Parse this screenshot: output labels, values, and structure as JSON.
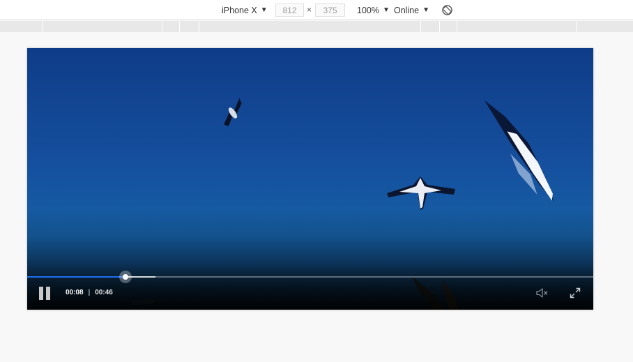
{
  "toolbar": {
    "device": "iPhone X",
    "width": "812",
    "height": "375",
    "times_symbol": "×",
    "zoom": "100%",
    "throttling": "Online",
    "icons": {
      "dropdown": "caret-down-icon",
      "rotate": "rotate-icon"
    }
  },
  "player": {
    "current_time": "00:08",
    "separator": "|",
    "duration": "00:46",
    "played_fraction": 0.174,
    "buffered_fraction": 0.226,
    "colors": {
      "progress_played": "#1e6ff0",
      "sky": "#15509e"
    },
    "icons": {
      "play_state": "pause-icon",
      "volume": "mute-icon",
      "fullscreen": "fullscreen-icon"
    }
  }
}
